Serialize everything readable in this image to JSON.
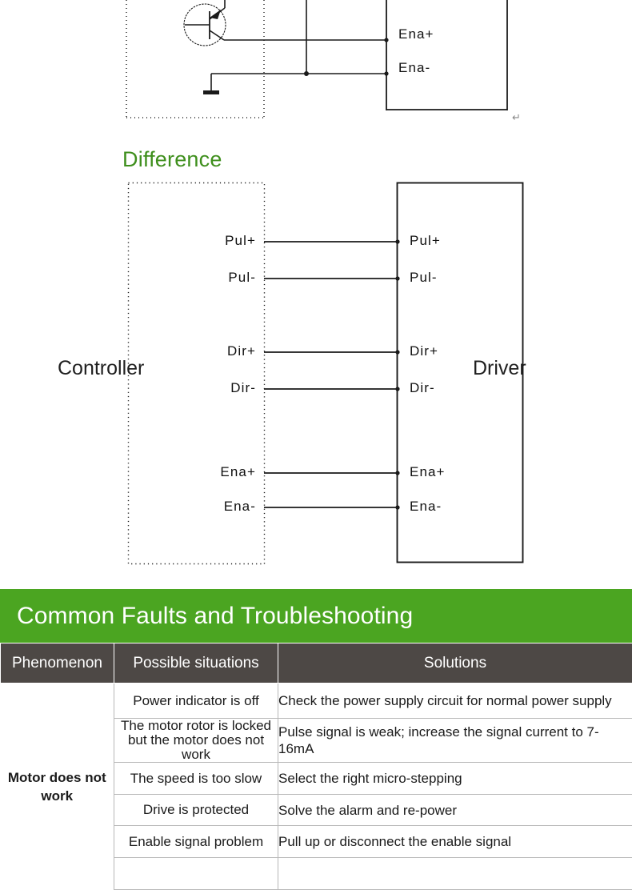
{
  "top_diagram": {
    "description": "single-ended enable wiring fragment with transistor and ground",
    "pins": [
      {
        "name": "Ena+",
        "label": "Ena+"
      },
      {
        "name": "Ena-",
        "label": "Ena-"
      }
    ],
    "paragraph_mark": "↵"
  },
  "difference_section": {
    "heading": "Difference",
    "heading_color": "#3f8f1d"
  },
  "diff_diagram": {
    "controller_label": "Controller",
    "driver_label": "Driver",
    "pairs": [
      {
        "controller": "Pul+",
        "driver": "Pul+"
      },
      {
        "controller": "Pul-",
        "driver": "Pul-"
      },
      {
        "controller": "Dir+",
        "driver": "Dir+"
      },
      {
        "controller": "Dir-",
        "driver": "Dir-"
      },
      {
        "controller": "Ena+",
        "driver": "Ena+"
      },
      {
        "controller": "Ena-",
        "driver": "Ena-"
      }
    ]
  },
  "faults_section": {
    "band_title": "Common Faults and Troubleshooting",
    "band_color": "#4ba521",
    "header_color": "#4d4845",
    "columns": [
      "Phenomenon",
      "Possible situations",
      "Solutions"
    ],
    "phenomenon": "Motor does not work",
    "rows": [
      {
        "situation": "Power indicator is off",
        "solution": "Check the power supply circuit for normal power supply"
      },
      {
        "situation": "The motor rotor is locked but the motor does not work",
        "solution": "Pulse signal is weak; increase the signal current to 7-16mA"
      },
      {
        "situation": "The speed is too slow",
        "solution": "Select the right micro-stepping"
      },
      {
        "situation": "Drive is protected",
        "solution": "Solve the alarm and re-power"
      },
      {
        "situation": "Enable signal problem",
        "solution": "Pull up or disconnect the enable signal"
      }
    ]
  }
}
